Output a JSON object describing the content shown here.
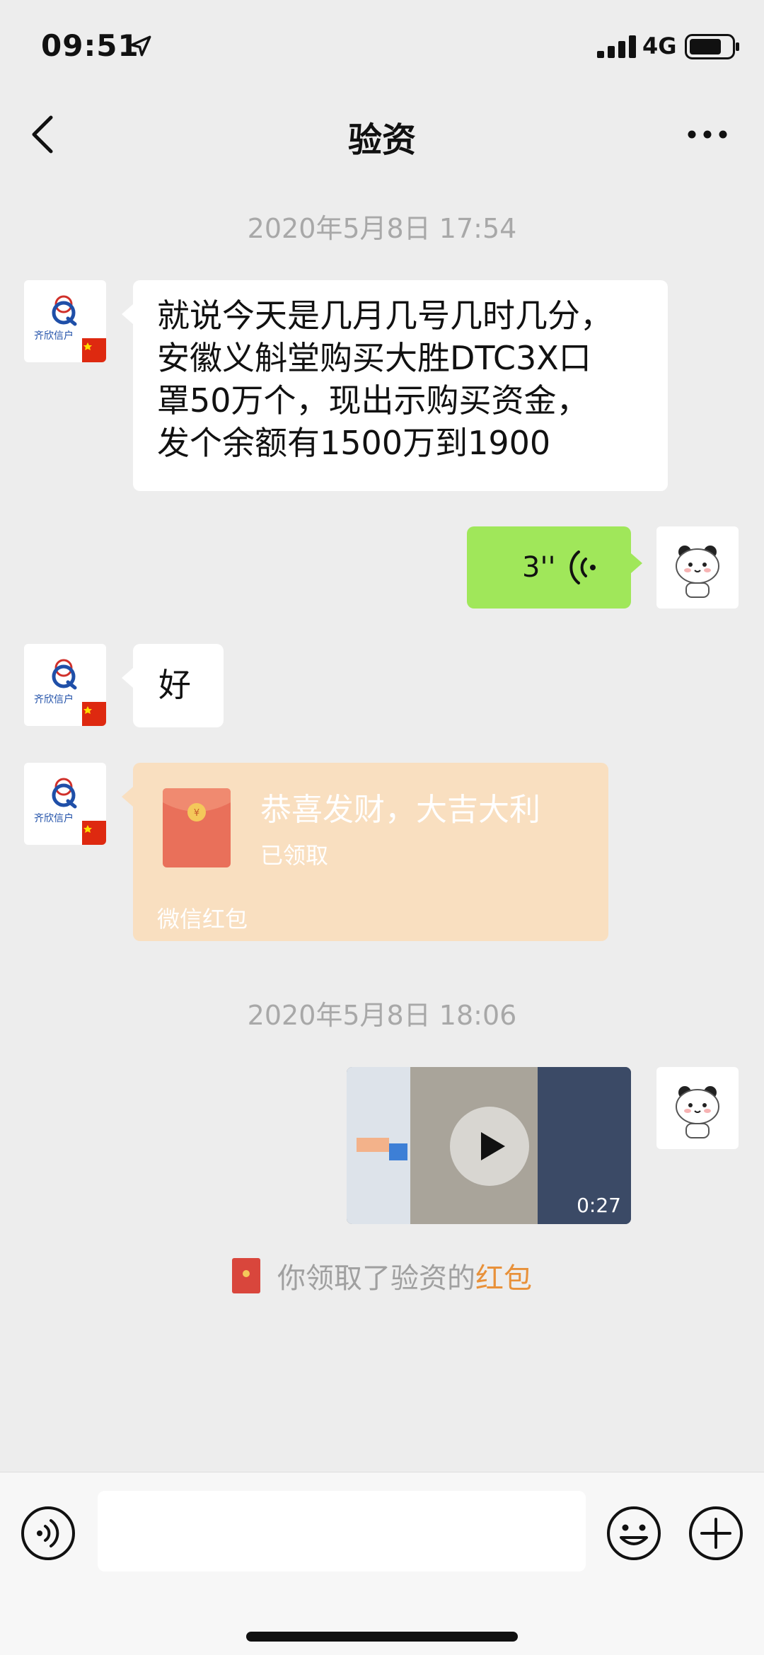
{
  "status_bar": {
    "time": "09:51",
    "network": "4G"
  },
  "header": {
    "title": "验资"
  },
  "messages": {
    "timestamp_1": "2020年5月8日 17:54",
    "msg1_lines": [
      "就说今天是几月几号几时几分，",
      "安徽义斛堂购买大胜DTC3X口",
      "罩50万个，现出示购买资金，",
      "发个余额有1500万到1900"
    ],
    "voice_duration": "3''",
    "msg3": "好",
    "red_packet": {
      "title": "恭喜发财，大吉大利",
      "status": "已领取",
      "footer": "微信红包"
    },
    "timestamp_2": "2020年5月8日 18:06",
    "video_duration": "0:27",
    "system_note": {
      "prefix": "你领取了验资的",
      "link": "红包"
    }
  },
  "avatar_logo_text": "齐欣信户",
  "colors": {
    "background": "#ededed",
    "sent_bubble": "#a0e75a",
    "red_packet": "#f9dfc0",
    "red_packet_link": "#e8913a",
    "timestamp_gray": "#a8a8a8"
  },
  "icons": {
    "back": "chevron-left-icon",
    "more": "ellipsis-icon",
    "voice_input": "voice-icon",
    "emoji": "emoji-icon",
    "add": "plus-circle-icon"
  }
}
